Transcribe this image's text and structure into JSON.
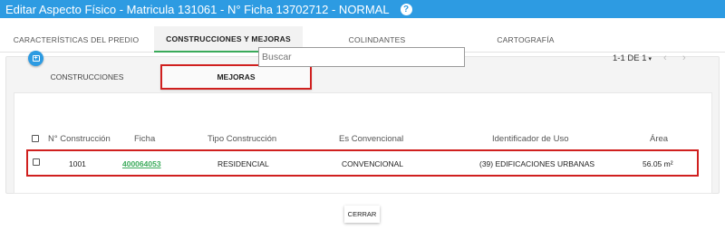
{
  "header": {
    "title": "Editar Aspecto Físico - Matricula 131061 - N° Ficha 13702712 - NORMAL",
    "help_icon": "?",
    "color": "#2d9be2"
  },
  "outer_tabs": [
    {
      "label": "CARACTERÍSTICAS DEL PREDIO",
      "active": false
    },
    {
      "label": "CONSTRUCCIONES Y MEJORAS",
      "active": true
    },
    {
      "label": "COLINDANTES",
      "active": false
    },
    {
      "label": "CARTOGRAFÍA",
      "active": false
    }
  ],
  "inner_tabs": [
    {
      "label": "CONSTRUCCIONES",
      "active": false
    },
    {
      "label": "MEJORAS",
      "active": true
    }
  ],
  "toolbar": {
    "add_icon": "add-document-icon",
    "search_placeholder": "Buscar",
    "pager_text": "1-1 DE 1",
    "pager_caret": "▾",
    "prev_icon": "‹",
    "next_icon": "›"
  },
  "table": {
    "columns": [
      "N° Construcción",
      "Ficha",
      "Tipo Construcción",
      "Es Convencional",
      "Identificador de Uso",
      "Área"
    ],
    "rows": [
      {
        "construccion": "1001",
        "ficha": "400064053",
        "tipo": "RESIDENCIAL",
        "convencional": "CONVENCIONAL",
        "uso": "(39) EDIFICACIONES URBANAS",
        "area": "56.05 m²"
      }
    ]
  },
  "footer": {
    "close_label": "CERRAR"
  },
  "colors": {
    "accent": "#2d9be2",
    "active_tab_underline": "#3aaa5a",
    "highlight": "#d0201f",
    "link": "#3aaa5a"
  }
}
